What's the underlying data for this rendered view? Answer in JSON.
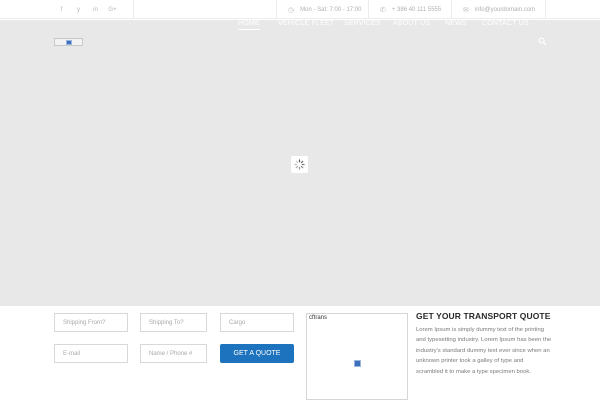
{
  "topbar": {
    "socials": [
      {
        "icon": "facebook-icon",
        "glyph": "f"
      },
      {
        "icon": "twitter-icon",
        "glyph": "y"
      },
      {
        "icon": "linkedin-icon",
        "glyph": "in"
      },
      {
        "icon": "google-plus-icon",
        "glyph": "G+"
      }
    ],
    "hours": "Mon - Sat: 7:00 - 17:00",
    "phone": "+ 386 40 111 5555",
    "email": "info@yourdomain.com"
  },
  "nav": {
    "items": [
      {
        "label": "HOME",
        "active": true
      },
      {
        "label": "VEHICLE FLEET",
        "active": false
      },
      {
        "label": "SERVICES",
        "active": false
      },
      {
        "label": "ABOUT US",
        "active": false
      },
      {
        "label": "NEWS",
        "active": false
      },
      {
        "label": "CONTACT US",
        "active": false
      }
    ]
  },
  "form": {
    "shipping_from": "Shipping From?",
    "shipping_to": "Shipping To?",
    "cargo": "Cargo",
    "email": "E-mail",
    "phone": "Name / Phone #",
    "submit": "GET A QUOTE"
  },
  "embed": {
    "label": "cftrans"
  },
  "quote": {
    "title": "GET YOUR TRANSPORT QUOTE",
    "body": "Lorem Ipsum is simply dummy text of the printing and typesetting industry. Lorem Ipsum has been the industry's standard dummy text ever since when an unknown printer took a galley of type and scrambled it to make a type specimen book."
  },
  "colors": {
    "accent": "#1e73be",
    "hero_bg": "#e8e8e8"
  }
}
